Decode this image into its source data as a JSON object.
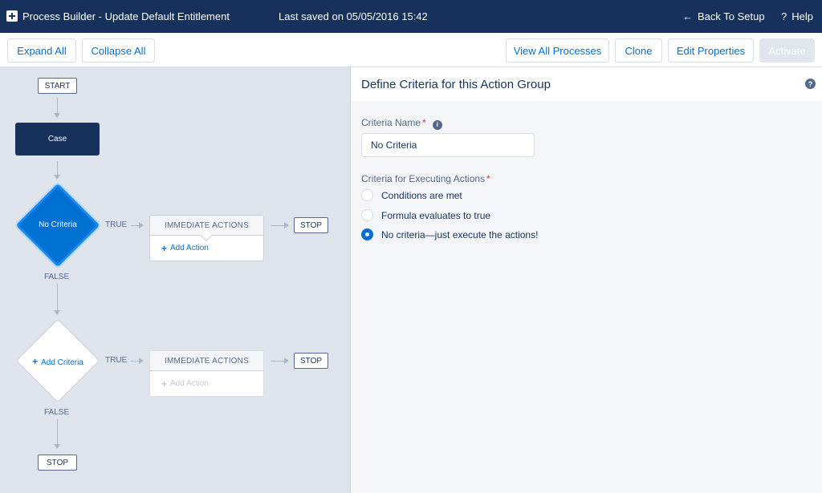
{
  "header": {
    "app_title": "Process Builder - Update Default Entitlement",
    "saved_text": "Last saved on 05/05/2016 15:42",
    "back_label": "Back To Setup",
    "help_label": "Help"
  },
  "toolbar": {
    "expand_all": "Expand All",
    "collapse_all": "Collapse All",
    "view_all_processes": "View All Processes",
    "clone": "Clone",
    "edit_properties": "Edit Properties",
    "activate": "Activate"
  },
  "canvas": {
    "start_label": "START",
    "object_label": "Case",
    "criteria_nodes": [
      {
        "label": "No Criteria",
        "true_label": "TRUE",
        "false_label": "FALSE",
        "actions_header": "IMMEDIATE ACTIONS",
        "add_action": "Add Action",
        "stop_label": "STOP"
      },
      {
        "label": "Add Criteria",
        "true_label": "TRUE",
        "false_label": "FALSE",
        "actions_header": "IMMEDIATE ACTIONS",
        "add_action": "Add Action",
        "stop_label": "STOP"
      }
    ],
    "end_label": "STOP"
  },
  "panel": {
    "title": "Define Criteria for this Action Group",
    "criteria_name_label": "Criteria Name",
    "criteria_name_value": "No Criteria",
    "executing_label": "Criteria for Executing Actions",
    "options": [
      {
        "label": "Conditions are met",
        "checked": false
      },
      {
        "label": "Formula evaluates to true",
        "checked": false
      },
      {
        "label": "No criteria—just execute the actions!",
        "checked": true
      }
    ]
  },
  "colors": {
    "header_bg": "#16325c",
    "accent": "#0070d2",
    "canvas_bg": "#dfe4ec",
    "required": "#c23934"
  }
}
